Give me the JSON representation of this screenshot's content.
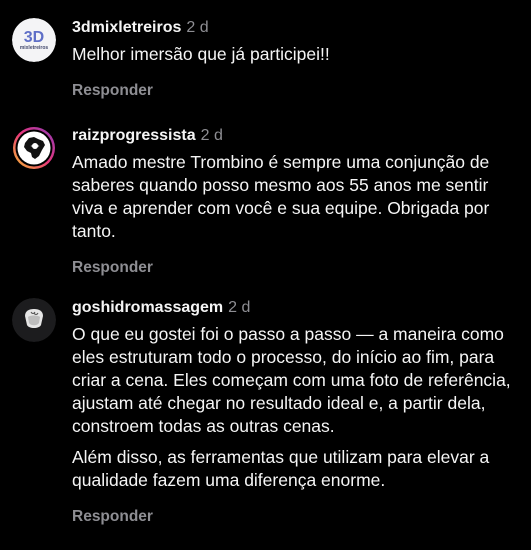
{
  "comments": [
    {
      "username": "3dmixletreiros",
      "time": "2 d",
      "avatar": {
        "text": "3D",
        "subtext": "mixletreiros",
        "icon": "3d-logo-icon",
        "bg": "#f4f4f6",
        "accent": "#5f6fc7"
      },
      "paragraphs": [
        "Melhor imersão que já participei!!"
      ],
      "reply": "Responder"
    },
    {
      "username": "raizprogressista",
      "time": "2 d",
      "avatar": {
        "icon": "brazil-map-icon",
        "ring": [
          "#f7c12f",
          "#e9367a",
          "#8a3ab9"
        ]
      },
      "paragraphs": [
        "Amado mestre Trombino é sempre uma conjunção de saberes quando posso mesmo aos 55 anos me sentir viva e aprender com você e sua equipe. Obrigada por tanto."
      ],
      "reply": "Responder"
    },
    {
      "username": "goshidromassagem",
      "time": "2 d",
      "avatar": {
        "icon": "hydromassage-logo-icon",
        "bg": "#1c1c1e"
      },
      "paragraphs": [
        "O que eu gostei foi o passo a passo — a maneira como eles estruturam todo o processo, do início ao fim, para criar a cena. Eles começam com uma foto de referência, ajustam até chegar no resultado ideal e, a partir dela, constroem todas as outras cenas.",
        "Além disso, as ferramentas que utilizam para elevar a qualidade fazem uma diferença enorme."
      ],
      "reply": "Responder"
    }
  ]
}
